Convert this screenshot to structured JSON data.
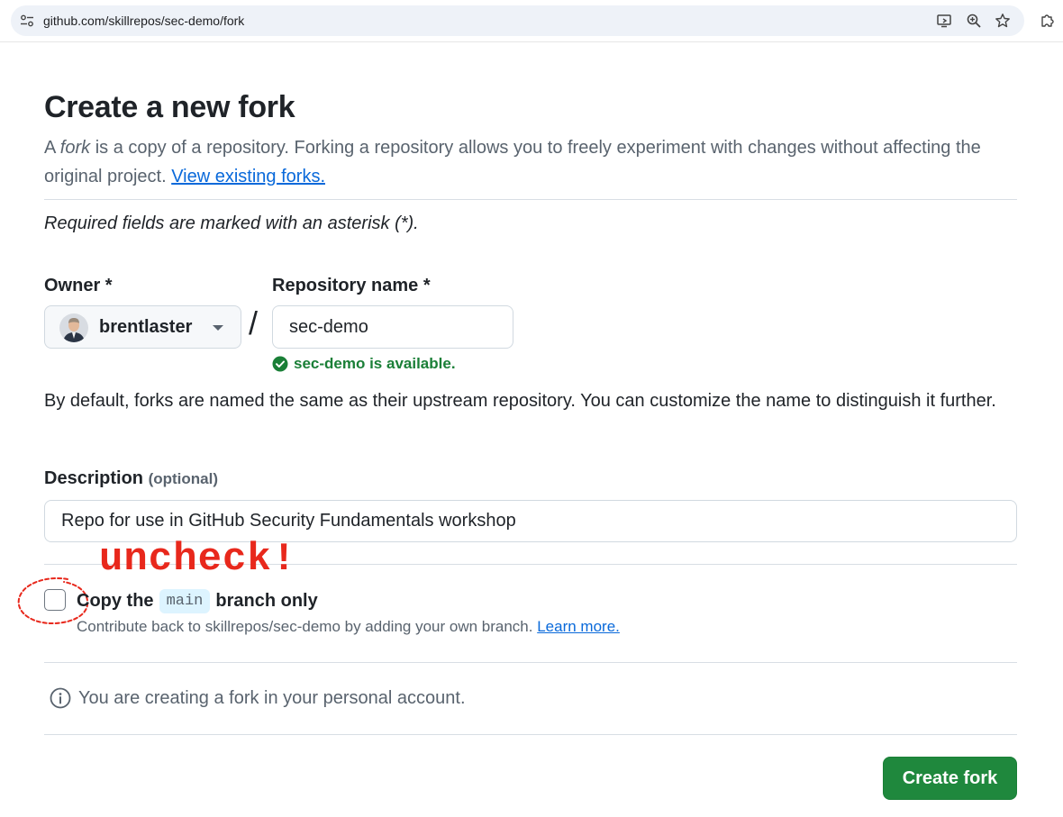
{
  "browser": {
    "url": "github.com/skillrepos/sec-demo/fork"
  },
  "page": {
    "title": "Create a new fork",
    "intro_prefix": "A ",
    "intro_em": "fork",
    "intro_rest": " is a copy of a repository. Forking a repository allows you to freely experiment with changes without affecting the original project. ",
    "intro_link": "View existing forks.",
    "required_note": "Required fields are marked with an asterisk (*)."
  },
  "form": {
    "owner_label": "Owner *",
    "owner_value": "brentlaster",
    "slash": "/",
    "repo_label": "Repository name *",
    "repo_value": "sec-demo",
    "availability": "sec-demo is available.",
    "default_note": "By default, forks are named the same as their upstream repository. You can customize the name to distinguish it further.",
    "description_label": "Description",
    "description_optional": "(optional)",
    "description_value": "Repo for use in GitHub Security Fundamentals workshop",
    "copy_prefix": "Copy the",
    "copy_branch": "main",
    "copy_suffix": "branch only",
    "copy_checked": false,
    "copy_help": "Contribute back to skillrepos/sec-demo by adding your own branch. ",
    "copy_help_link": "Learn more.",
    "info_text": "You are creating a fork in your personal account.",
    "create_button": "Create fork"
  },
  "annotation": {
    "text": "uncheck!"
  },
  "colors": {
    "primary_button": "#1f883d",
    "success_text": "#1a7f37",
    "link": "#0969da",
    "annotation": "#e8281c"
  },
  "icons": [
    "tune-icon",
    "cast-icon",
    "zoom-icon",
    "star-icon",
    "extensions-icon",
    "chevron-down-icon",
    "check-circle-icon",
    "info-icon"
  ]
}
